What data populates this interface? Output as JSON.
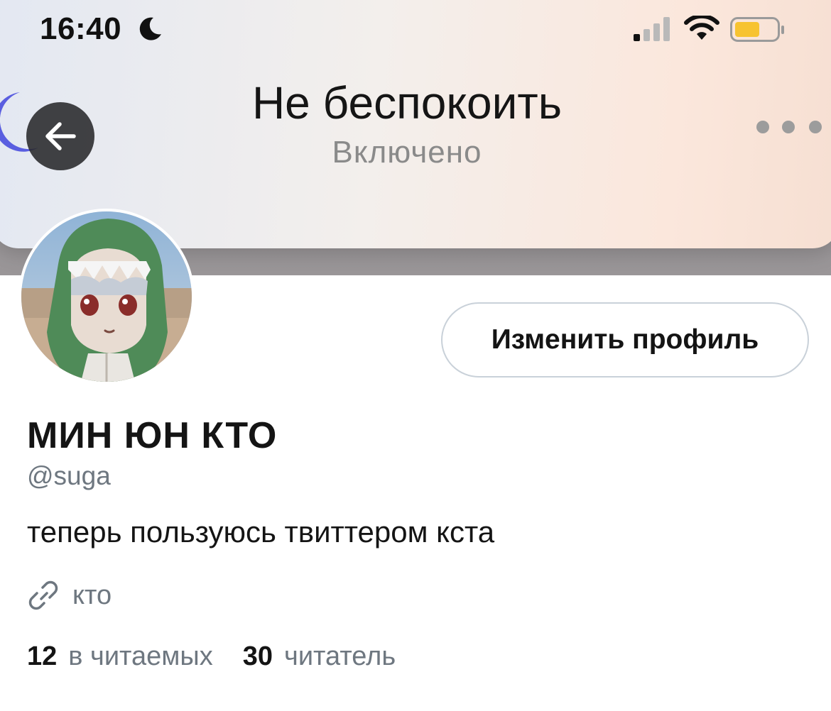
{
  "status_bar": {
    "time": "16:40",
    "icons": [
      "moon-icon",
      "signal-icon",
      "wifi-icon",
      "battery-icon"
    ]
  },
  "banner": {
    "title": "Не беспокоить",
    "subtitle": "Включено"
  },
  "profile": {
    "edit_button": "Изменить профиль",
    "name": "МИН ЮН КТО",
    "handle": "@suga",
    "bio": "теперь пользуюсь твиттером кста",
    "link": "кто",
    "following_count": "12",
    "following_label": "в читаемых",
    "followers_count": "30",
    "followers_label": "читатель"
  },
  "colors": {
    "text_primary": "#141414",
    "text_secondary": "#6e7780",
    "border": "#c9d1d9",
    "battery_fill": "#f7c331",
    "dnd_moon": "#5a5ee0"
  }
}
